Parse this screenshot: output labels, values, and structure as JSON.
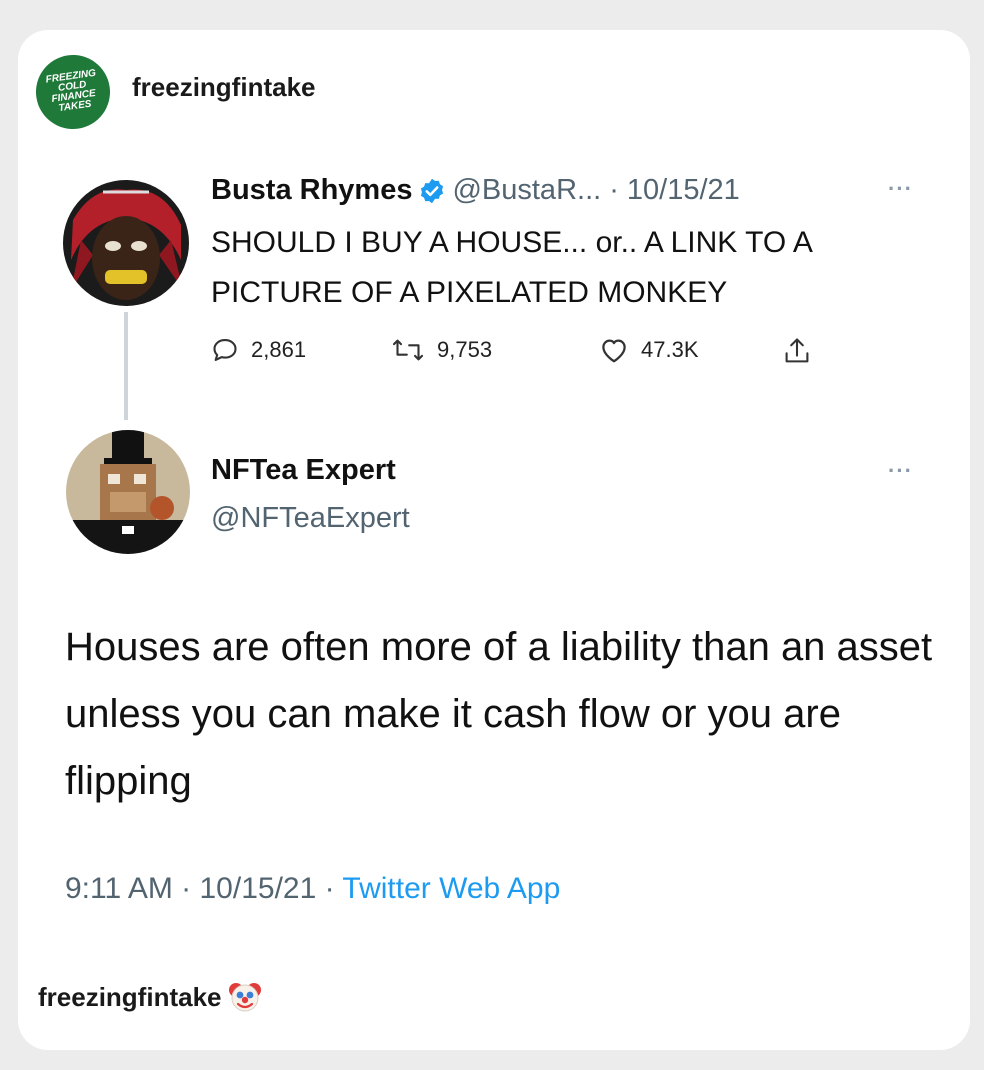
{
  "post": {
    "brand_badge": "FREEZING COLD FINANCE TAKES",
    "account": "freezingfintake",
    "footer_account": "freezingfintake",
    "footer_emoji": "clown-face-icon"
  },
  "tweet1": {
    "name": "Busta Rhymes",
    "handle": "@BustaR...",
    "date": "· 10/15/21",
    "body": "SHOULD I BUY A HOUSE... or.. A LINK TO A PICTURE OF A PIXELATED MONKEY",
    "replies": "2,861",
    "retweets": "9,753",
    "likes": "47.3K",
    "icons": [
      "reply-icon",
      "retweet-icon",
      "like-icon",
      "share-icon",
      "verified-icon"
    ]
  },
  "tweet2": {
    "name": "NFTea Expert",
    "handle": "@NFTeaExpert",
    "body": "Houses are often more of a liability than an asset unless you can make it cash flow or you are flipping",
    "time": "9:11 AM · 10/15/21 · ",
    "source": "Twitter Web App"
  },
  "colors": {
    "link_blue": "#1d9bf0",
    "muted_gray": "#536471",
    "brand_green": "#1f7a3a"
  }
}
